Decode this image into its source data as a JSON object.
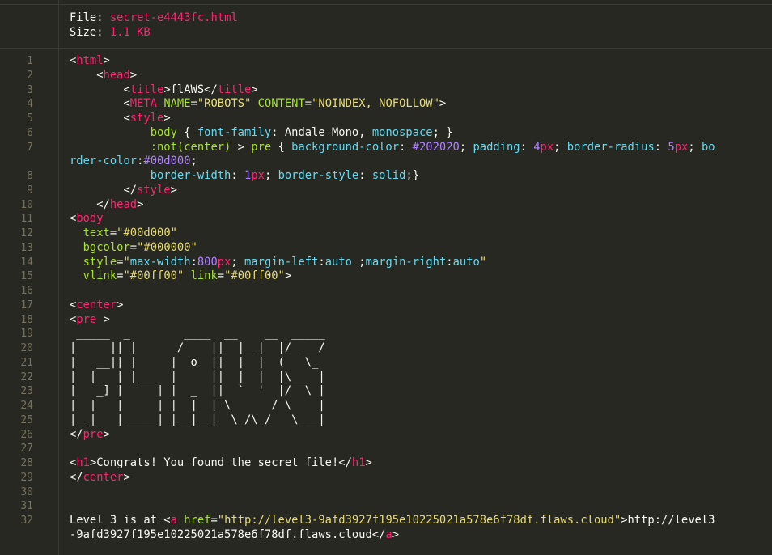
{
  "file_header": {
    "file_label": "File:",
    "file_name": "secret-e4443fc.html",
    "size_label": "Size:",
    "size_value": "1.1 KB"
  },
  "line_numbers": [
    "1",
    "2",
    "3",
    "4",
    "5",
    "6",
    "7",
    "8",
    "9",
    "10",
    "11",
    "12",
    "13",
    "14",
    "15",
    "16",
    "17",
    "18",
    "19",
    "20",
    "21",
    "22",
    "23",
    "24",
    "25",
    "26",
    "27",
    "28",
    "29",
    "30",
    "31",
    "32"
  ],
  "code_lines": [
    {
      "segments": [
        {
          "c": "w",
          "t": "<"
        },
        {
          "c": "t",
          "t": "html"
        },
        {
          "c": "w",
          "t": ">"
        }
      ]
    },
    {
      "segments": [
        {
          "c": "w",
          "t": "    <"
        },
        {
          "c": "t",
          "t": "head"
        },
        {
          "c": "w",
          "t": ">"
        }
      ]
    },
    {
      "segments": [
        {
          "c": "w",
          "t": "        <"
        },
        {
          "c": "t",
          "t": "title"
        },
        {
          "c": "w",
          "t": ">flAWS</"
        },
        {
          "c": "t",
          "t": "title"
        },
        {
          "c": "w",
          "t": ">"
        }
      ]
    },
    {
      "segments": [
        {
          "c": "w",
          "t": "        <"
        },
        {
          "c": "t",
          "t": "META"
        },
        {
          "c": "w",
          "t": " "
        },
        {
          "c": "a",
          "t": "NAME"
        },
        {
          "c": "w",
          "t": "="
        },
        {
          "c": "s",
          "t": "\"ROBOTS\""
        },
        {
          "c": "w",
          "t": " "
        },
        {
          "c": "a",
          "t": "CONTENT"
        },
        {
          "c": "w",
          "t": "="
        },
        {
          "c": "s",
          "t": "\"NOINDEX, NOFOLLOW\""
        },
        {
          "c": "w",
          "t": ">"
        }
      ]
    },
    {
      "segments": [
        {
          "c": "w",
          "t": "        <"
        },
        {
          "c": "t",
          "t": "style"
        },
        {
          "c": "w",
          "t": ">"
        }
      ]
    },
    {
      "segments": [
        {
          "c": "w",
          "t": "            "
        },
        {
          "c": "a",
          "t": "body"
        },
        {
          "c": "w",
          "t": " { "
        },
        {
          "c": "k",
          "t": "font-family"
        },
        {
          "c": "w",
          "t": ": Andale Mono, "
        },
        {
          "c": "k",
          "t": "monospace"
        },
        {
          "c": "w",
          "t": "; }"
        }
      ]
    },
    {
      "segments": [
        {
          "c": "w",
          "t": "            "
        },
        {
          "c": "a",
          "t": ":not(center)"
        },
        {
          "c": "w",
          "t": " > "
        },
        {
          "c": "a",
          "t": "pre"
        },
        {
          "c": "w",
          "t": " { "
        },
        {
          "c": "k",
          "t": "background-color"
        },
        {
          "c": "w",
          "t": ": "
        },
        {
          "c": "n",
          "t": "#202020"
        },
        {
          "c": "w",
          "t": "; "
        },
        {
          "c": "k",
          "t": "padding"
        },
        {
          "c": "w",
          "t": ": "
        },
        {
          "c": "n",
          "t": "4"
        },
        {
          "c": "t",
          "t": "px"
        },
        {
          "c": "w",
          "t": "; "
        },
        {
          "c": "k",
          "t": "border-radius"
        },
        {
          "c": "w",
          "t": ": "
        },
        {
          "c": "n",
          "t": "5"
        },
        {
          "c": "t",
          "t": "px"
        },
        {
          "c": "w",
          "t": "; "
        },
        {
          "c": "k",
          "t": "bo"
        }
      ]
    },
    {
      "segments": [
        {
          "c": "k",
          "t": "rder-color"
        },
        {
          "c": "w",
          "t": ":"
        },
        {
          "c": "n",
          "t": "#00d000"
        },
        {
          "c": "w",
          "t": ";"
        }
      ],
      "wrap": true
    },
    {
      "segments": [
        {
          "c": "w",
          "t": "            "
        },
        {
          "c": "k",
          "t": "border-width"
        },
        {
          "c": "w",
          "t": ": "
        },
        {
          "c": "n",
          "t": "1"
        },
        {
          "c": "t",
          "t": "px"
        },
        {
          "c": "w",
          "t": "; "
        },
        {
          "c": "k",
          "t": "border-style"
        },
        {
          "c": "w",
          "t": ": "
        },
        {
          "c": "k",
          "t": "solid"
        },
        {
          "c": "w",
          "t": ";}"
        }
      ]
    },
    {
      "segments": [
        {
          "c": "w",
          "t": "        </"
        },
        {
          "c": "t",
          "t": "style"
        },
        {
          "c": "w",
          "t": ">"
        }
      ]
    },
    {
      "segments": [
        {
          "c": "w",
          "t": "    </"
        },
        {
          "c": "t",
          "t": "head"
        },
        {
          "c": "w",
          "t": ">"
        }
      ]
    },
    {
      "segments": [
        {
          "c": "w",
          "t": "<"
        },
        {
          "c": "t",
          "t": "body"
        }
      ]
    },
    {
      "segments": [
        {
          "c": "w",
          "t": "  "
        },
        {
          "c": "a",
          "t": "text"
        },
        {
          "c": "w",
          "t": "="
        },
        {
          "c": "s",
          "t": "\"#00d000\""
        }
      ]
    },
    {
      "segments": [
        {
          "c": "w",
          "t": "  "
        },
        {
          "c": "a",
          "t": "bgcolor"
        },
        {
          "c": "w",
          "t": "="
        },
        {
          "c": "s",
          "t": "\"#000000\""
        }
      ]
    },
    {
      "segments": [
        {
          "c": "w",
          "t": "  "
        },
        {
          "c": "a",
          "t": "style"
        },
        {
          "c": "w",
          "t": "="
        },
        {
          "c": "s",
          "t": "\""
        },
        {
          "c": "k",
          "t": "max-width"
        },
        {
          "c": "w",
          "t": ":"
        },
        {
          "c": "n",
          "t": "800"
        },
        {
          "c": "t",
          "t": "px"
        },
        {
          "c": "w",
          "t": "; "
        },
        {
          "c": "k",
          "t": "margin-left"
        },
        {
          "c": "w",
          "t": ":"
        },
        {
          "c": "k",
          "t": "auto"
        },
        {
          "c": "w",
          "t": " ;"
        },
        {
          "c": "k",
          "t": "margin-right"
        },
        {
          "c": "w",
          "t": ":"
        },
        {
          "c": "k",
          "t": "auto"
        },
        {
          "c": "s",
          "t": "\""
        }
      ]
    },
    {
      "segments": [
        {
          "c": "w",
          "t": "  "
        },
        {
          "c": "a",
          "t": "vlink"
        },
        {
          "c": "w",
          "t": "="
        },
        {
          "c": "s",
          "t": "\"#00ff00\""
        },
        {
          "c": "w",
          "t": " "
        },
        {
          "c": "a",
          "t": "link"
        },
        {
          "c": "w",
          "t": "="
        },
        {
          "c": "s",
          "t": "\"#00ff00\""
        },
        {
          "c": "w",
          "t": ">"
        }
      ]
    },
    {
      "segments": []
    },
    {
      "segments": [
        {
          "c": "w",
          "t": "<"
        },
        {
          "c": "t",
          "t": "center"
        },
        {
          "c": "w",
          "t": ">"
        }
      ]
    },
    {
      "segments": [
        {
          "c": "w",
          "t": "<"
        },
        {
          "c": "t",
          "t": "pre"
        },
        {
          "c": "w",
          "t": " >"
        }
      ]
    },
    {
      "segments": [
        {
          "c": "w",
          "t": " _____  _        ____  __    __  _____"
        }
      ]
    },
    {
      "segments": [
        {
          "c": "w",
          "t": "|     || |      /    ||  |__|  |/ ___/"
        }
      ]
    },
    {
      "segments": [
        {
          "c": "w",
          "t": "|   __|| |     |  o  ||  |  |  (   \\_"
        }
      ]
    },
    {
      "segments": [
        {
          "c": "w",
          "t": "|  |_  | |___  |     ||  |  |  |\\__  |"
        }
      ]
    },
    {
      "segments": [
        {
          "c": "w",
          "t": "|   _] |     | |  _  ||  `  '  |/  \\ |"
        }
      ]
    },
    {
      "segments": [
        {
          "c": "w",
          "t": "|  |   |     | |  |  | \\      / \\    |"
        }
      ]
    },
    {
      "segments": [
        {
          "c": "w",
          "t": "|__|   |_____| |__|__|  \\_/\\_/   \\___|"
        }
      ]
    },
    {
      "segments": [
        {
          "c": "w",
          "t": "</"
        },
        {
          "c": "t",
          "t": "pre"
        },
        {
          "c": "w",
          "t": ">"
        }
      ]
    },
    {
      "segments": []
    },
    {
      "segments": [
        {
          "c": "w",
          "t": "<"
        },
        {
          "c": "t",
          "t": "h1"
        },
        {
          "c": "w",
          "t": ">Congrats! You found the secret file!</"
        },
        {
          "c": "t",
          "t": "h1"
        },
        {
          "c": "w",
          "t": ">"
        }
      ]
    },
    {
      "segments": [
        {
          "c": "w",
          "t": "</"
        },
        {
          "c": "t",
          "t": "center"
        },
        {
          "c": "w",
          "t": ">"
        }
      ]
    },
    {
      "segments": []
    },
    {
      "segments": []
    },
    {
      "segments": [
        {
          "c": "w",
          "t": "Level 3 is at <"
        },
        {
          "c": "t",
          "t": "a"
        },
        {
          "c": "w",
          "t": " "
        },
        {
          "c": "a",
          "t": "href"
        },
        {
          "c": "w",
          "t": "="
        },
        {
          "c": "s",
          "t": "\"http://level3-9afd3927f195e10225021a578e6f78df.flaws.cloud\""
        },
        {
          "c": "w",
          "t": ">http://level3"
        }
      ]
    },
    {
      "segments": [
        {
          "c": "w",
          "t": "-9afd3927f195e10225021a578e6f78df.flaws.cloud</"
        },
        {
          "c": "t",
          "t": "a"
        },
        {
          "c": "w",
          "t": ">"
        }
      ],
      "wrap": true
    }
  ],
  "colors": {
    "background": "#272822",
    "tag": "#f92672",
    "string": "#e6db74",
    "attribute": "#a6e22e",
    "keyword": "#66d9ef",
    "number": "#ae81ff",
    "line_number": "#75715e"
  }
}
